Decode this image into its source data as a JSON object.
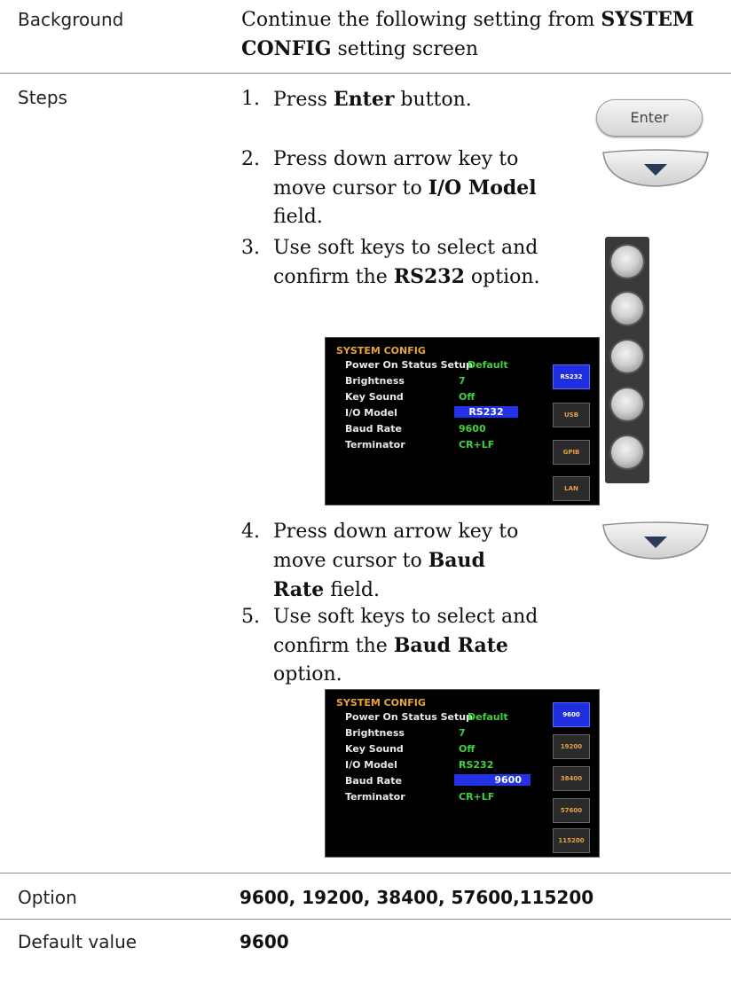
{
  "background": {
    "label": "Background",
    "text_prefix": "Continue the following setting from ",
    "text_bold": "SYSTEM CONFIG",
    "text_suffix": " setting screen"
  },
  "steps": {
    "label": "Steps",
    "items": [
      {
        "num": "1.",
        "pre": "Press ",
        "bold": "Enter",
        "post": " button."
      },
      {
        "num": "2.",
        "pre": "Press down arrow key to move cursor to ",
        "bold": "I/O Model",
        "post": " field."
      },
      {
        "num": "3.",
        "pre": "Use soft keys to select and confirm the ",
        "bold": "RS232",
        "post": " option."
      },
      {
        "num": "4.",
        "pre": "Press down arrow key to move cursor to ",
        "bold": "Baud Rate",
        "post": " field."
      },
      {
        "num": "5.",
        "pre": "Use soft keys to select and confirm the ",
        "bold": "Baud Rate",
        "post": " option."
      }
    ],
    "enter_button_label": "Enter"
  },
  "screen1": {
    "title": "SYSTEM CONFIG",
    "rows": [
      {
        "label": "Power On Status Setup",
        "value": "Default"
      },
      {
        "label": "Brightness",
        "value": "7"
      },
      {
        "label": "Key Sound",
        "value": "Off"
      },
      {
        "label": "I/O Model",
        "value": "RS232"
      },
      {
        "label": "Baud Rate",
        "value": "9600"
      },
      {
        "label": "Terminator",
        "value": "CR+LF"
      }
    ],
    "selected_row": 3,
    "softkeys": [
      "RS232",
      "USB",
      "GPIB",
      "LAN"
    ],
    "active_softkey": 0
  },
  "screen2": {
    "title": "SYSTEM CONFIG",
    "rows": [
      {
        "label": "Power On Status Setup",
        "value": "Default"
      },
      {
        "label": "Brightness",
        "value": "7"
      },
      {
        "label": "Key Sound",
        "value": "Off"
      },
      {
        "label": "I/O Model",
        "value": "RS232"
      },
      {
        "label": "Baud Rate",
        "value": "9600"
      },
      {
        "label": "Terminator",
        "value": "CR+LF"
      }
    ],
    "selected_row": 4,
    "softkeys": [
      "9600",
      "19200",
      "38400",
      "57600",
      "115200"
    ],
    "active_softkey": 0
  },
  "option": {
    "label": "Option",
    "value": "9600, 19200, 38400, 57600,115200"
  },
  "default_value": {
    "label": "Default value",
    "value": "9600"
  },
  "colors": {
    "screen_title": "#e8a33c",
    "value_green": "#3fd23f",
    "selection_blue": "#2332e6",
    "softkey_text": "#e6a04a"
  }
}
